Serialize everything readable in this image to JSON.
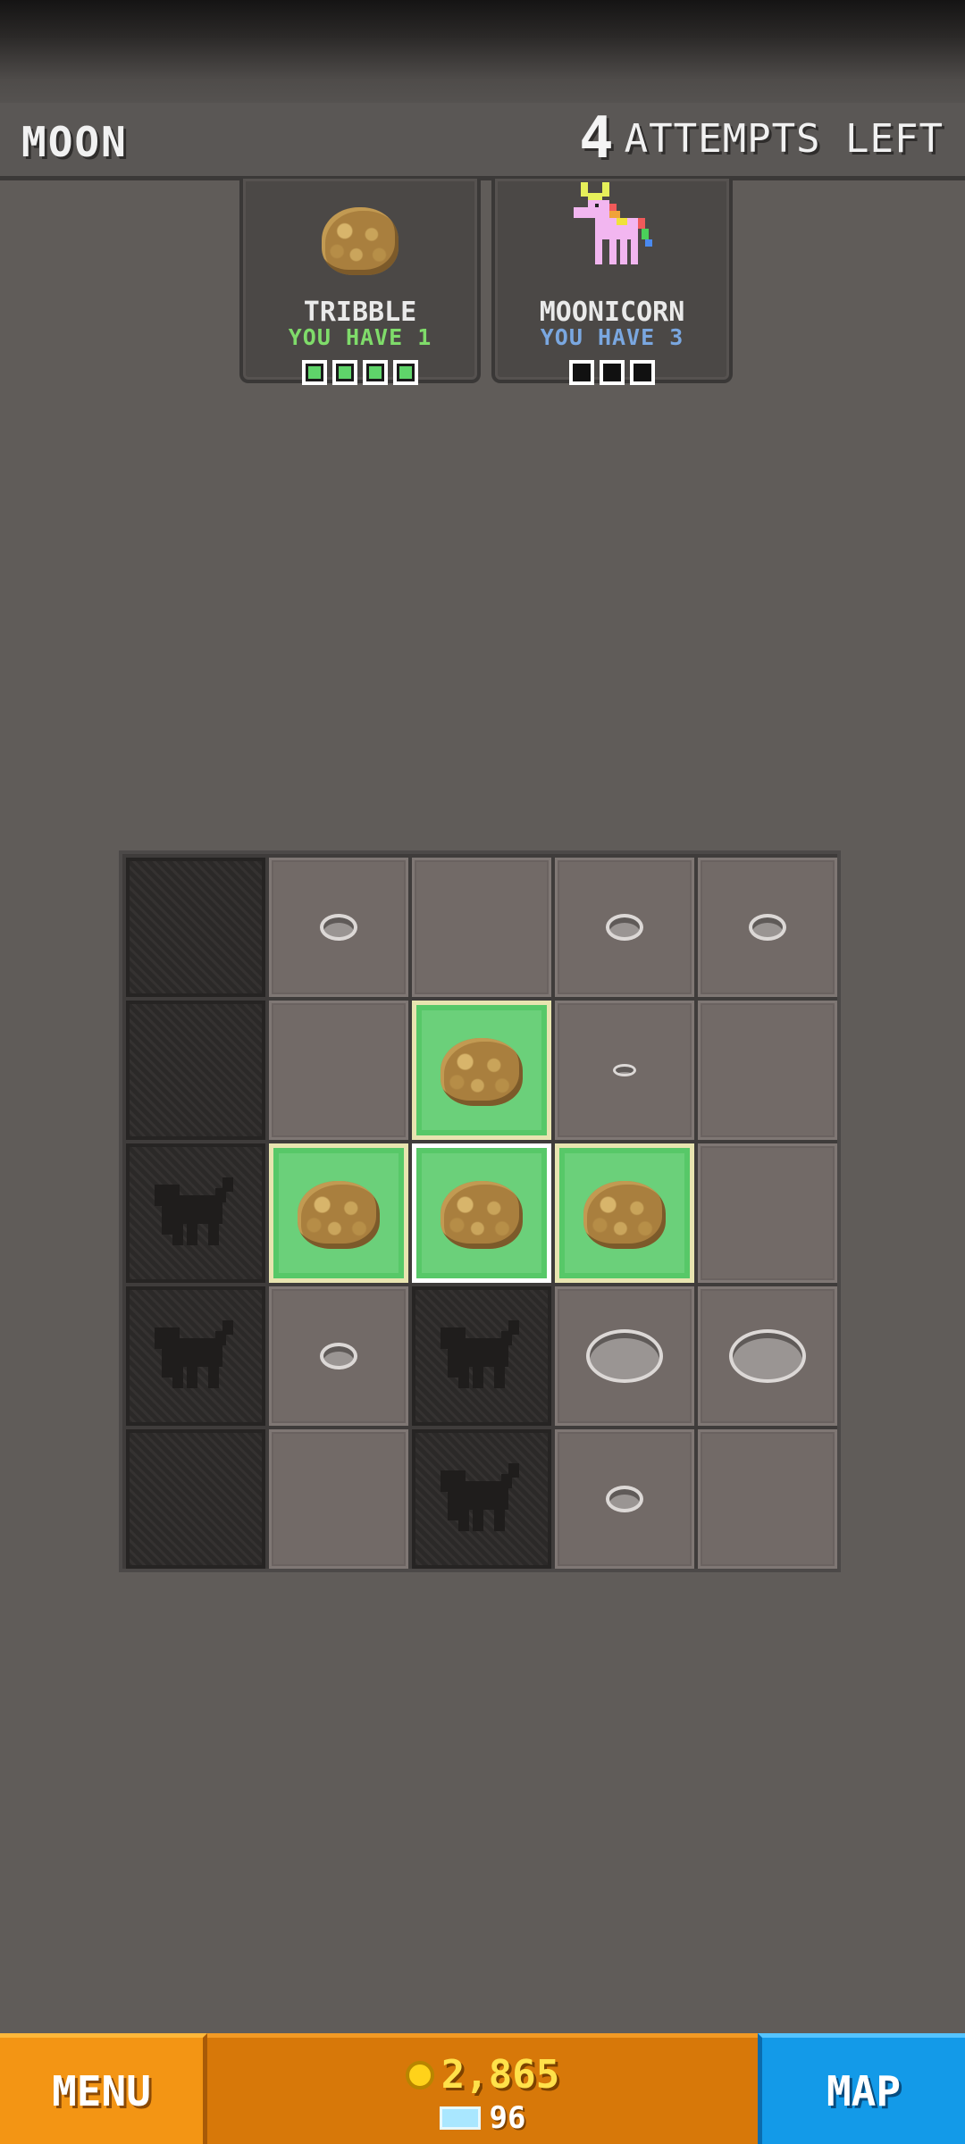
{
  "header": {
    "level_name": "MOON",
    "attempts_count": "4",
    "attempts_label": "ATTEMPTS LEFT"
  },
  "targets": [
    {
      "name": "TRIBBLE",
      "have": "YOU HAVE 1",
      "have_color": "#7fdc6a",
      "slots_total": 4,
      "slots_found": 4
    },
    {
      "name": "MOONICORN",
      "have": "YOU HAVE 3",
      "have_color": "#7aa7e0",
      "slots_total": 3,
      "slots_found": 0
    }
  ],
  "grid": {
    "rows": [
      [
        "dark",
        "hole",
        "dirt",
        "hole",
        "hole"
      ],
      [
        "dark",
        "dirt",
        "tribble",
        "small-hole",
        "dirt"
      ],
      [
        "monkey",
        "tribble",
        "tribble-selected",
        "tribble",
        "dirt"
      ],
      [
        "monkey",
        "hole",
        "monkey",
        "big-hole",
        "big-hole"
      ],
      [
        "dark",
        "dirt",
        "monkey",
        "hole",
        "dirt"
      ]
    ]
  },
  "bottom_bar": {
    "menu_label": "MENU",
    "coins": "2,865",
    "gems": "96",
    "map_label": "MAP"
  },
  "colors": {
    "background": "#605c59",
    "menu": "#f39514",
    "wallet": "#d77809",
    "map": "#139ae8"
  }
}
